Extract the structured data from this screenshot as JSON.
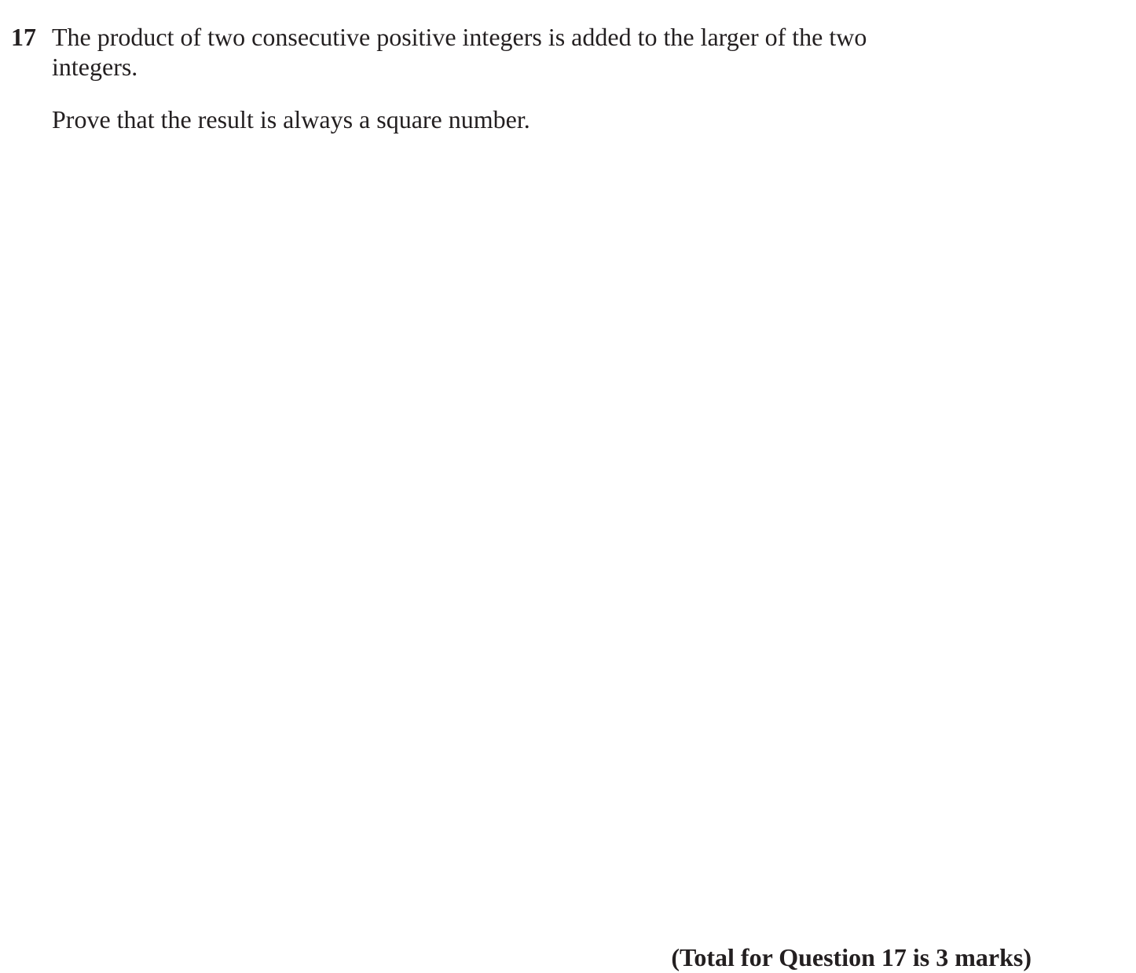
{
  "question": {
    "number": "17",
    "stem": "The product of two consecutive positive integers is added to the larger of the two integers.",
    "prompt": "Prove that the result is always a square number.",
    "total": "(Total for Question 17 is 3 marks)"
  }
}
